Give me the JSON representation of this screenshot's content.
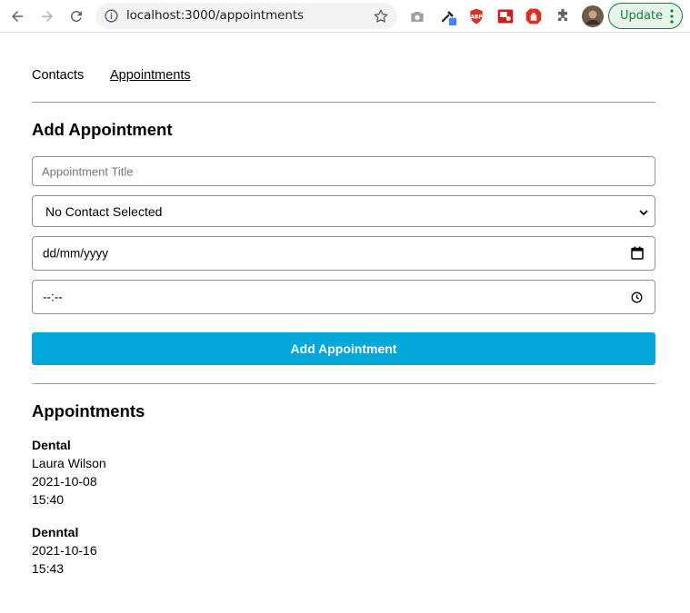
{
  "browser": {
    "url": "localhost:3000/appointments",
    "update_label": "Update"
  },
  "nav": {
    "contacts": "Contacts",
    "appointments": "Appointments"
  },
  "form": {
    "heading": "Add Appointment",
    "title_placeholder": "Appointment Title",
    "contact_selected": "No Contact Selected",
    "date_placeholder": "dd/mm/yyyy",
    "time_placeholder": "--:--",
    "submit_label": "Add Appointment"
  },
  "list": {
    "heading": "Appointments",
    "items": [
      {
        "title": "Dental",
        "contact": "Laura Wilson",
        "date": "2021-10-08",
        "time": "15:40"
      },
      {
        "title": "Denntal",
        "date": "2021-10-16",
        "time": "15:43"
      }
    ]
  },
  "colors": {
    "accent": "#03a7d9",
    "update_green": "#188038"
  }
}
